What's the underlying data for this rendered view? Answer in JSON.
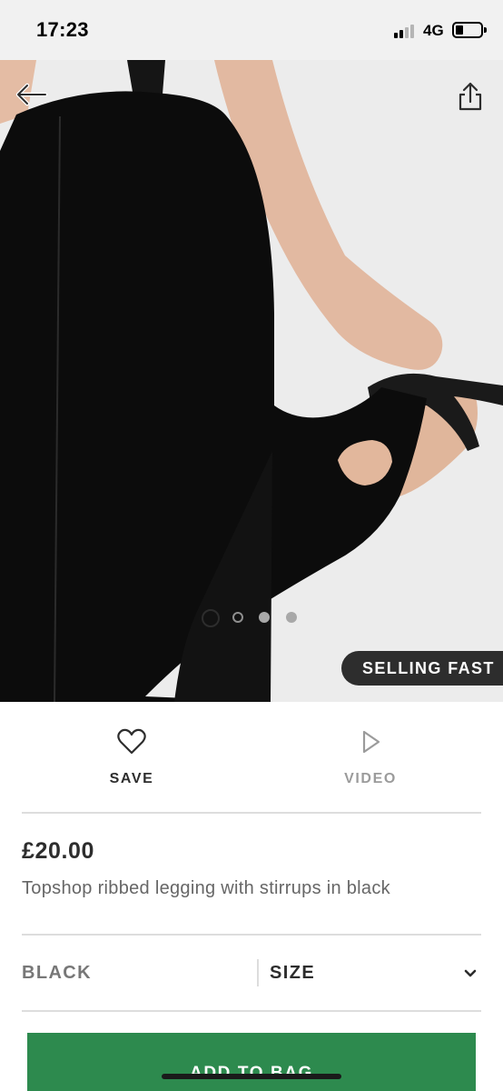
{
  "status_bar": {
    "time": "17:23",
    "network": "4G",
    "signal_bars_active": 2,
    "signal_bars_total": 4,
    "battery_level": 0.2
  },
  "gallery": {
    "badge": "SELLING FAST",
    "dot_count": 4,
    "active_index": 0,
    "back_icon": "arrow-left-icon",
    "share_icon": "share-icon"
  },
  "actions": {
    "save": {
      "label": "SAVE",
      "icon": "heart-icon"
    },
    "video": {
      "label": "VIDEO",
      "icon": "play-icon"
    }
  },
  "product": {
    "price": "£20.00",
    "title": "Topshop ribbed legging with stirrups in black"
  },
  "selectors": {
    "colour": "BLACK",
    "size": "SIZE",
    "size_icon": "chevron-down-icon"
  },
  "cta": {
    "label": "ADD TO BAG",
    "color": "#2d8a4e"
  },
  "colors": {
    "text": "#2d2d2d",
    "muted": "#9b9b9b",
    "badge_bg": "#2d2d2d"
  }
}
